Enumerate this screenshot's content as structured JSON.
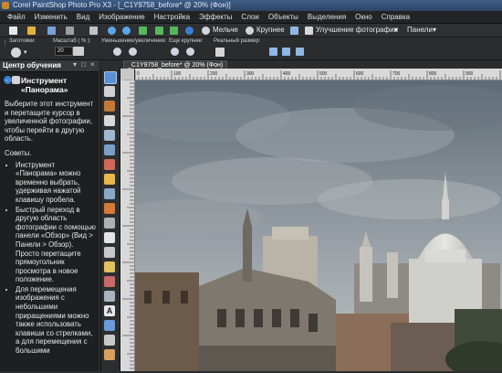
{
  "window": {
    "title": "Corel PaintShop Photo Pro X3 - [_C1Y9758_before* @ 20% (Фон)]"
  },
  "menu": [
    "Файл",
    "Изменить",
    "Вид",
    "Изображение",
    "Настройка",
    "Эффекты",
    "Слои",
    "Объекты",
    "Выделения",
    "Окно",
    "Справка"
  ],
  "toolbar": {
    "zoom_out_label": "Мельче",
    "zoom_in_label": "Крупнее",
    "enhance_label": "Улучшение фотографии",
    "panels_label": "Панели"
  },
  "options_bar": {
    "presets_label": "Заготовки:",
    "zoom_label": "Масштаб ( % ):",
    "zoom_value": "20",
    "zoom_out_label": "Уменьшение/увеличение:",
    "zoom_in_label": "Еще крупнее:",
    "actual_size_label": "Реальный размер:"
  },
  "learning_center": {
    "title": "Центр обучения",
    "heading": "Инструмент «Панорама»",
    "intro": "Выберите этот инструмент и перетащите курсор в увеличенной фотографии, чтобы перейти в другую область.",
    "tips_title": "Советы.",
    "tips": [
      "Инструмент «Панорама» можно временно выбрать, удерживая нажатой клавишу пробела.",
      "Быстрый переход в другую область фотографии с помощью панели «Обзор» (Вид > Панели > Обзор). Просто перетащите прямоугольник просмотра в новое положение.",
      "Для перемещения изображения с небольшими приращениями можно также использовать клавиши со стрелками, а для перемещения с большими"
    ]
  },
  "document": {
    "tab_label": "_C1Y9758_before* @  20% (Фон)"
  },
  "ruler_labels": [
    "0",
    "100",
    "200",
    "300",
    "400",
    "500",
    "600",
    "700",
    "800",
    "900",
    "1000"
  ]
}
